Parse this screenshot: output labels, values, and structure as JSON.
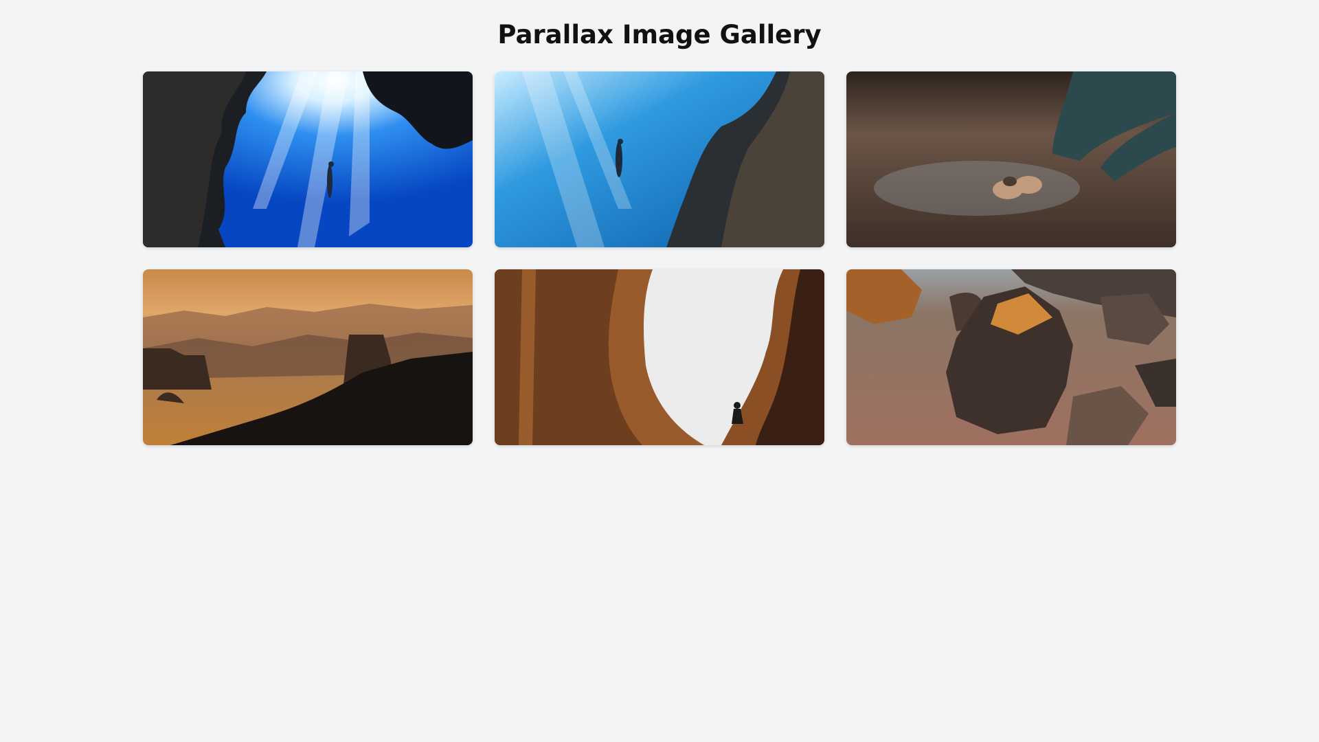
{
  "page": {
    "title": "Parallax Image Gallery",
    "background": "#f3f4f6"
  },
  "gallery": {
    "images": [
      {
        "subject": "freediver descending beneath reef cave opening with sunbeams",
        "palette": [
          "#0a5fd6",
          "#1f2a33",
          "#bfe6ff"
        ]
      },
      {
        "subject": "freediver ascending beside coral reef wall in blue water",
        "palette": [
          "#1d86d1",
          "#2b2f35",
          "#a9dcfa"
        ]
      },
      {
        "subject": "hands holding rock over rocky desert ground",
        "palette": [
          "#5b4a3e",
          "#2d4a4c",
          "#c29a7c"
        ]
      },
      {
        "subject": "desert mountain silhouettes at golden sunset",
        "palette": [
          "#c98a4a",
          "#1a1614",
          "#e7b57e"
        ]
      },
      {
        "subject": "climber silhouetted between sandstone cliffs",
        "palette": [
          "#9a5b2c",
          "#2a1a12",
          "#eeeeee"
        ]
      },
      {
        "subject": "aerial view of sandstone rock formations in desert",
        "palette": [
          "#8b6b54",
          "#3d3430",
          "#d08a3a"
        ]
      }
    ]
  }
}
